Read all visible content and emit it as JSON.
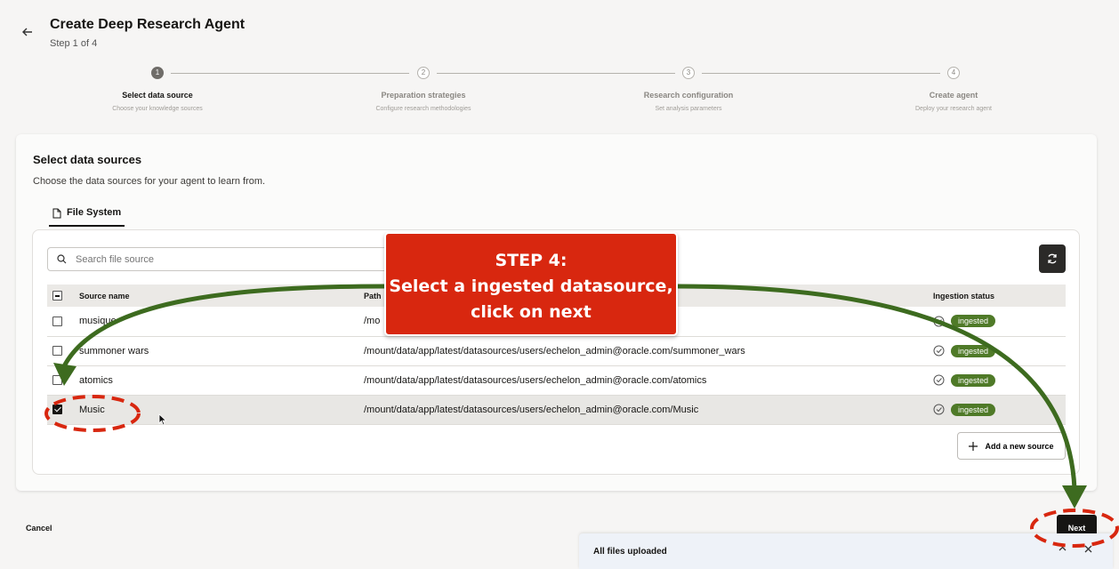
{
  "header": {
    "title": "Create Deep Research Agent",
    "step_indicator": "Step 1 of 4"
  },
  "stepper": {
    "steps": [
      {
        "number": "1",
        "title": "Select data source",
        "subtitle": "Choose your knowledge sources",
        "active": true
      },
      {
        "number": "2",
        "title": "Preparation strategies",
        "subtitle": "Configure research methodologies",
        "active": false
      },
      {
        "number": "3",
        "title": "Research configuration",
        "subtitle": "Set analysis parameters",
        "active": false
      },
      {
        "number": "4",
        "title": "Create agent",
        "subtitle": "Deploy your research agent",
        "active": false
      }
    ]
  },
  "card": {
    "title": "Select data sources",
    "description": "Choose the data sources for your agent to learn from.",
    "tab_label": "File System"
  },
  "search": {
    "placeholder": "Search file source"
  },
  "table": {
    "columns": [
      "Source name",
      "Path",
      "Ingestion status"
    ],
    "rows": [
      {
        "name": "musique",
        "path": "/mo",
        "status": "ingested",
        "checked": false
      },
      {
        "name": "summoner wars",
        "path": "/mount/data/app/latest/datasources/users/echelon_admin@oracle.com/summoner_wars",
        "status": "ingested",
        "checked": false
      },
      {
        "name": "atomics",
        "path": "/mount/data/app/latest/datasources/users/echelon_admin@oracle.com/atomics",
        "status": "ingested",
        "checked": false
      },
      {
        "name": "Music",
        "path": "/mount/data/app/latest/datasources/users/echelon_admin@oracle.com/Music",
        "status": "ingested",
        "checked": true
      }
    ]
  },
  "actions": {
    "add_source": "Add a new source",
    "cancel": "Cancel",
    "next": "Next"
  },
  "toast": {
    "text": "All files uploaded"
  },
  "callout": {
    "line1": "STEP 4:",
    "line2": "Select a ingested datasource,",
    "line3": "click on next"
  },
  "colors": {
    "accent_dark": "#161513",
    "badge_green": "#4f7a28",
    "callout_red": "#d8270f",
    "annotation_arrow": "#3d6b1f",
    "annotation_dashes": "#d8270f"
  }
}
